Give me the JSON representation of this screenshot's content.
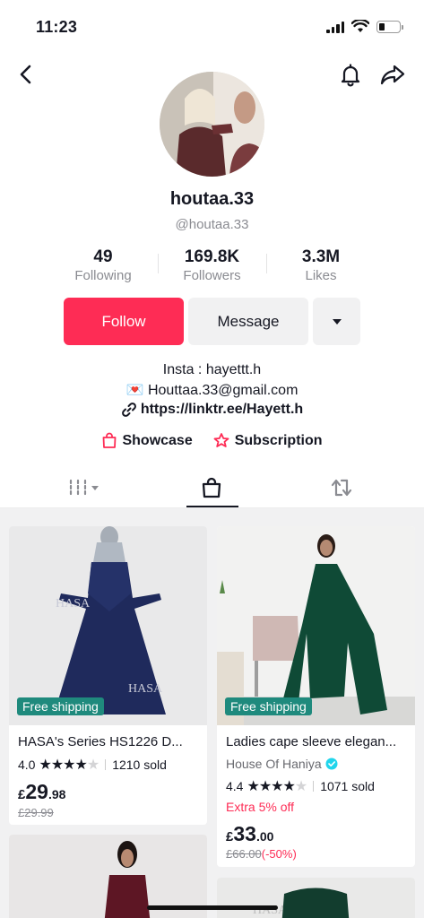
{
  "status_bar": {
    "time": "11:23"
  },
  "profile": {
    "username": "houtaa.33",
    "handle": "@houtaa.33",
    "stats": {
      "following": {
        "value": "49",
        "label": "Following"
      },
      "followers": {
        "value": "169.8K",
        "label": "Followers"
      },
      "likes": {
        "value": "3.3M",
        "label": "Likes"
      }
    },
    "buttons": {
      "follow": "Follow",
      "message": "Message"
    },
    "bio": {
      "line1": "Insta : hayettt.h",
      "line2_emoji": "💌",
      "line2": "Houttaa.33@gmail.com",
      "link": "https://linktr.ee/Hayett.h"
    },
    "features": {
      "showcase": "Showcase",
      "subscription": "Subscription"
    }
  },
  "colors": {
    "accent": "#fe2c55",
    "badge": "#1f8a7d"
  },
  "products": [
    {
      "badge": "Free shipping",
      "title": "HASA's Series  HS1226 D...",
      "rating": "4.0",
      "stars_filled": 4,
      "sold": "1210 sold",
      "price_currency": "£",
      "price_whole": "29",
      "price_decimal": ".98",
      "old_price": "£29.99"
    },
    {
      "badge": "Free shipping",
      "title": "Ladies cape sleeve elegan...",
      "store": "House Of Haniya",
      "rating": "4.4",
      "stars_filled": 4,
      "sold": "1071 sold",
      "extra": "Extra 5% off",
      "price_currency": "£",
      "price_whole": "33",
      "price_decimal": ".00",
      "old_price": "£66.00",
      "discount": "(-50%)"
    }
  ]
}
